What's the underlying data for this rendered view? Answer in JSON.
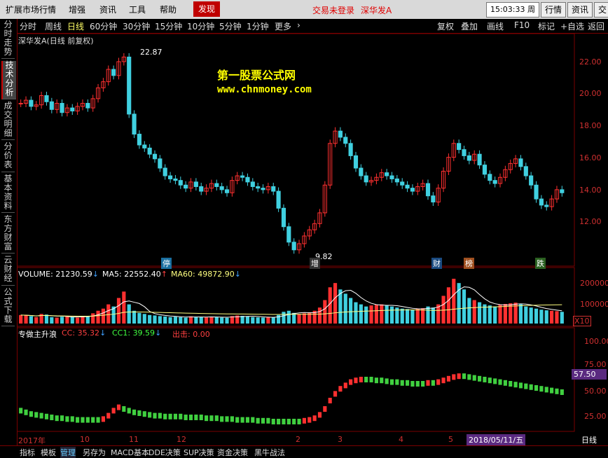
{
  "menu": {
    "items": [
      "扩展市场行情",
      "增强",
      "资讯",
      "工具",
      "帮助"
    ],
    "discover": "发现",
    "trade_status": "交易未登录",
    "stock_title": "深华发A",
    "clock_time": "15:03:33",
    "clock_day": "周日",
    "right_buttons": [
      "行情",
      "资讯",
      "交易"
    ]
  },
  "toolbar": {
    "periods": [
      "分时",
      "周线",
      "日线",
      "60分钟",
      "30分钟",
      "15分钟",
      "10分钟",
      "5分钟",
      "1分钟",
      "更多"
    ],
    "selected_period": "日线",
    "more_arrow": "›",
    "actions": [
      "复权",
      "叠加",
      "画线",
      "F10",
      "标记",
      "+自选",
      "返回"
    ]
  },
  "sidebar": {
    "tabs": [
      "分时走势",
      "技术分析",
      "成交明细",
      "分价表",
      "基本资料",
      "东方财富",
      "云财经",
      "公式下载"
    ],
    "active": "技术分析"
  },
  "main_chart": {
    "header": "深华发A(日线 前复权)",
    "watermark_title": "第一股票公式网",
    "watermark_url": "www.chnmoney.com",
    "high_label": "22.87",
    "low_label": "9.82",
    "y_ticks": [
      "22.00",
      "20.00",
      "18.00",
      "16.00",
      "14.00",
      "12.00"
    ],
    "event_markers": [
      "停",
      "增",
      "财",
      "榜",
      "跌"
    ]
  },
  "volume": {
    "label_volume": "VOLUME: 21230.59",
    "label_ma5": "MA5: 22552.40",
    "label_ma60": "MA60: 49872.90",
    "y_ticks": [
      "200000",
      "100000"
    ],
    "unit": "X10"
  },
  "indicator": {
    "name": "专做主升浪",
    "cc": "CC: 35.32",
    "cc1": "CC1: 39.59",
    "out": "出击: 0.00",
    "y_ticks": [
      "100.00",
      "75.00",
      "50.00",
      "25.00"
    ],
    "current_value": "57.50"
  },
  "x_axis": {
    "labels": [
      "2017年",
      "10",
      "11",
      "12",
      "2",
      "3",
      "4",
      "5"
    ],
    "cursor_date": "2018/05/11/五",
    "period_label": "日线"
  },
  "bottom_tabs": [
    "指标",
    "模板",
    "管理",
    "另存为",
    "MACD基本",
    "DDE决策",
    "SUP决策",
    "资金决策",
    "黑牛战法"
  ],
  "bottom_active": "管理",
  "chart_data": {
    "type": "candlestick",
    "title": "深华发A(日线 前复权)",
    "ylim": [
      9.5,
      23.3
    ],
    "close_series": [
      19.6,
      19.8,
      19.4,
      19.5,
      20.1,
      19.7,
      19.2,
      19.6,
      19.0,
      19.3,
      19.1,
      19.4,
      19.6,
      19.3,
      19.9,
      20.6,
      21.0,
      21.8,
      21.4,
      22.3,
      22.6,
      18.9,
      17.6,
      16.9,
      16.7,
      16.3,
      16.0,
      15.4,
      14.9,
      14.7,
      14.6,
      14.3,
      14.1,
      14.5,
      14.2,
      13.9,
      14.1,
      14.4,
      14.2,
      14.0,
      13.8,
      14.6,
      14.9,
      14.8,
      14.5,
      14.2,
      14.1,
      14.0,
      14.2,
      13.9,
      12.8,
      11.6,
      10.6,
      10.1,
      10.5,
      11.0,
      11.4,
      11.8,
      12.5,
      14.3,
      17.0,
      17.8,
      17.4,
      17.0,
      16.2,
      15.4,
      14.9,
      14.5,
      14.6,
      14.8,
      15.1,
      14.9,
      14.7,
      14.5,
      14.3,
      14.1,
      13.9,
      14.2,
      14.4,
      13.6,
      13.2,
      14.1,
      15.2,
      16.1,
      17.0,
      16.6,
      16.2,
      15.9,
      16.3,
      15.6,
      15.0,
      14.6,
      14.4,
      14.8,
      15.3,
      15.7,
      16.0,
      15.5,
      14.9,
      14.3,
      13.4,
      13.0,
      12.9,
      13.4,
      14.0,
      13.8
    ],
    "volume_series": [
      40,
      38,
      35,
      30,
      45,
      42,
      30,
      28,
      32,
      35,
      30,
      28,
      34,
      36,
      48,
      60,
      70,
      90,
      80,
      120,
      150,
      90,
      60,
      50,
      45,
      40,
      38,
      35,
      33,
      30,
      32,
      30,
      28,
      34,
      31,
      30,
      29,
      33,
      30,
      28,
      27,
      35,
      38,
      36,
      33,
      30,
      29,
      28,
      30,
      29,
      40,
      55,
      60,
      50,
      45,
      48,
      52,
      60,
      75,
      110,
      170,
      190,
      160,
      140,
      120,
      100,
      90,
      80,
      85,
      88,
      90,
      85,
      80,
      75,
      70,
      68,
      65,
      70,
      72,
      80,
      75,
      90,
      130,
      170,
      210,
      190,
      160,
      120,
      110,
      100,
      90,
      85,
      80,
      88,
      92,
      95,
      98,
      90,
      80,
      75,
      70,
      65,
      62,
      60,
      58,
      55
    ],
    "indicator_series": [
      18,
      16,
      14,
      13,
      12,
      11,
      10,
      9,
      9,
      8,
      8,
      7,
      7,
      7,
      7,
      7,
      8,
      12,
      18,
      22,
      20,
      18,
      16,
      15,
      14,
      13,
      12,
      12,
      11,
      11,
      11,
      11,
      10,
      10,
      10,
      10,
      9,
      9,
      9,
      8,
      8,
      8,
      7,
      7,
      7,
      7,
      6,
      6,
      6,
      5,
      5,
      5,
      5,
      5,
      5,
      6,
      7,
      9,
      13,
      20,
      30,
      38,
      44,
      48,
      52,
      54,
      55,
      55,
      55,
      54,
      54,
      53,
      52,
      52,
      51,
      51,
      50,
      50,
      50,
      51,
      51,
      52,
      54,
      56,
      58,
      59,
      59,
      58,
      57,
      56,
      55,
      54,
      53,
      52,
      51,
      50,
      49,
      48,
      47,
      46,
      45,
      44,
      43,
      42,
      41,
      40
    ]
  }
}
